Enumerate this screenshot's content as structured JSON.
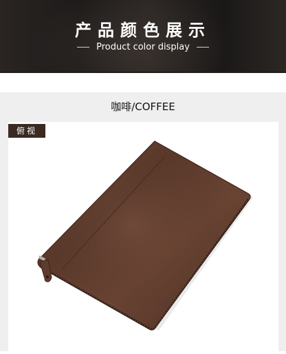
{
  "banner": {
    "title": "产品颜色展示",
    "subtitle": "Product color display"
  },
  "section": {
    "color_name": "咖啡/COFFEE",
    "view_tag": "俯视"
  },
  "colors": {
    "banner_bg": "#1c1a19",
    "section_bg": "#efefef",
    "tag_bg": "#3a2a22",
    "leather": "#5a3a2c"
  }
}
